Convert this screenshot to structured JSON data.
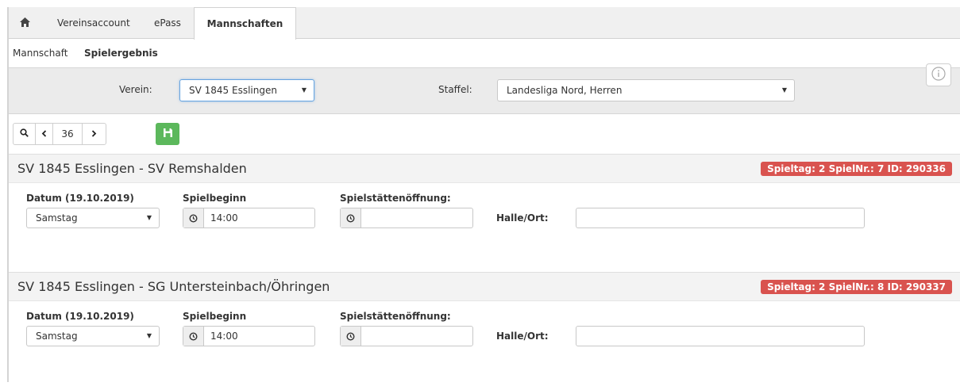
{
  "tabs": {
    "items": [
      {
        "label": "Vereinsaccount"
      },
      {
        "label": "ePass"
      },
      {
        "label": "Mannschaften"
      }
    ]
  },
  "subnav": {
    "items": [
      {
        "label": "Mannschaft"
      },
      {
        "label": "Spielergebnis"
      }
    ]
  },
  "filters": {
    "verein_label": "Verein:",
    "verein_value": "SV 1845 Esslingen",
    "staffel_label": "Staffel:",
    "staffel_value": "Landesliga Nord, Herren"
  },
  "toolbar": {
    "page_number": "36"
  },
  "games": [
    {
      "title": "SV 1845 Esslingen - SV Remshalden",
      "badge": "Spieltag: 2 SpielNr.: 7 ID: 290336",
      "datum_label": "Datum (19.10.2019)",
      "day_value": "Samstag",
      "spielbeginn_label": "Spielbeginn",
      "spielbeginn_value": "14:00",
      "oeffnung_label": "Spielstättenöffnung:",
      "oeffnung_value": "",
      "halle_label": "Halle/Ort:",
      "halle_value": ""
    },
    {
      "title": "SV 1845 Esslingen - SG Untersteinbach/Öhringen",
      "badge": "Spieltag: 2 SpielNr.: 8 ID: 290337",
      "datum_label": "Datum (19.10.2019)",
      "day_value": "Samstag",
      "spielbeginn_label": "Spielbeginn",
      "spielbeginn_value": "14:00",
      "oeffnung_label": "Spielstättenöffnung:",
      "oeffnung_value": "",
      "halle_label": "Halle/Ort:",
      "halle_value": ""
    }
  ],
  "colors": {
    "badge": "#d9534f",
    "save_button": "#5cb85c",
    "focus_border": "#66a3e0"
  },
  "icons": [
    "home-icon",
    "search-icon",
    "chevron-left-icon",
    "chevron-right-icon",
    "save-icon",
    "info-icon",
    "clock-icon",
    "caret-down-icon"
  ]
}
